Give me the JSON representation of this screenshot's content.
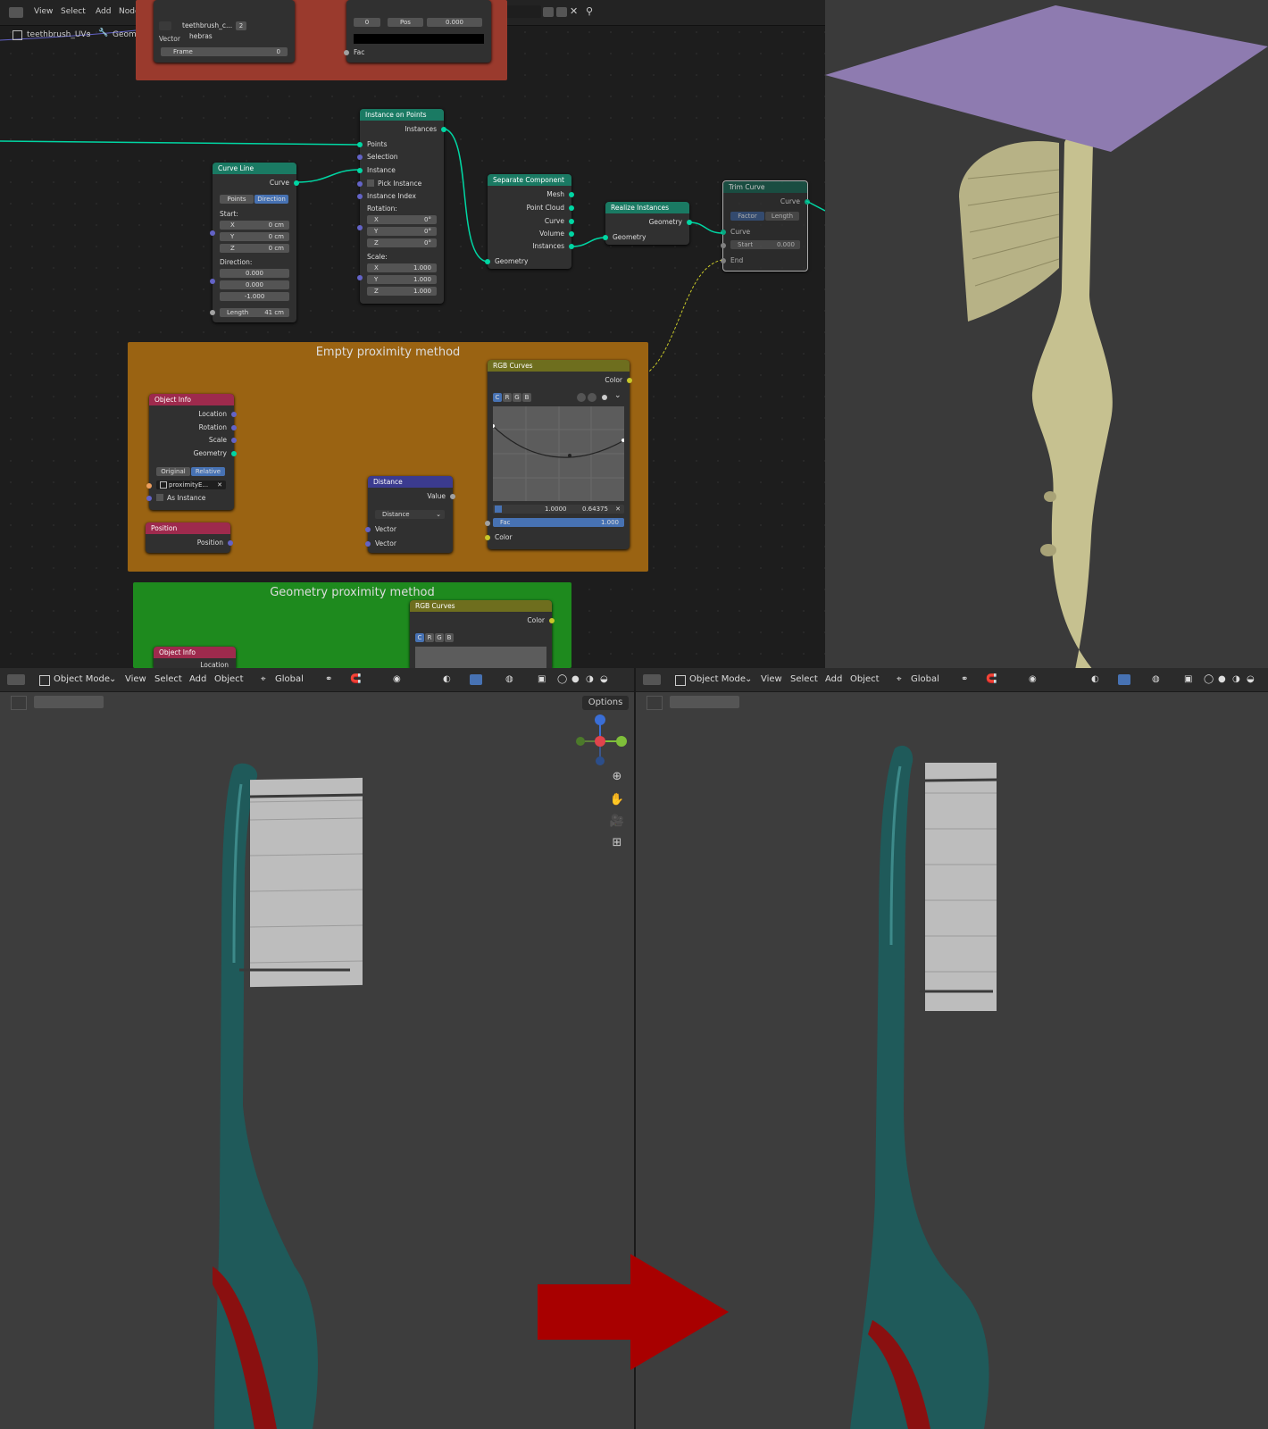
{
  "node_editor": {
    "menu": [
      "View",
      "Select",
      "Add",
      "Node"
    ],
    "tree_name": "hebras",
    "breadcrumb": [
      "teethbrush_UVs",
      "GeometryNodes",
      "hebras"
    ],
    "top_node": {
      "obj": "teethbrush_c...",
      "users": "2",
      "vector_label": "Vector",
      "frame_label": "Frame",
      "frame_value": "0",
      "fac_label": "Fac",
      "pos_label": "Pos",
      "pos_value": "0.000",
      "left_value": "0"
    },
    "instance_on_points": {
      "title": "Instance on Points",
      "out": "Instances",
      "inputs": [
        "Points",
        "Selection",
        "Instance",
        "Pick Instance",
        "Instance Index"
      ],
      "rotation_label": "Rotation:",
      "rotation": [
        [
          "X",
          "0°"
        ],
        [
          "Y",
          "0°"
        ],
        [
          "Z",
          "0°"
        ]
      ],
      "scale_label": "Scale:",
      "scale": [
        [
          "X",
          "1.000"
        ],
        [
          "Y",
          "1.000"
        ],
        [
          "Z",
          "1.000"
        ]
      ]
    },
    "curve_line": {
      "title": "Curve Line",
      "out": "Curve",
      "modes": [
        "Points",
        "Direction"
      ],
      "start_label": "Start:",
      "start": [
        [
          "X",
          "0 cm"
        ],
        [
          "Y",
          "0 cm"
        ],
        [
          "Z",
          "0 cm"
        ]
      ],
      "direction_label": "Direction:",
      "direction": [
        "0.000",
        "0.000",
        "-1.000"
      ],
      "length_label": "Length",
      "length_value": "41 cm"
    },
    "separate_component": {
      "title": "Separate Component",
      "outs": [
        "Mesh",
        "Point Cloud",
        "Curve",
        "Volume",
        "Instances"
      ],
      "in": "Geometry"
    },
    "realize_instances": {
      "title": "Realize Instances",
      "out": "Geometry",
      "in": "Geometry"
    },
    "trim_curve": {
      "title": "Trim Curve",
      "out": "Curve",
      "modes": [
        "Factor",
        "Length"
      ],
      "in_curve": "Curve",
      "start_label": "Start",
      "start_value": "0.000",
      "end_label": "End"
    },
    "frame_empty": {
      "title": "Empty proximity method"
    },
    "object_info": {
      "title": "Object Info",
      "outs": [
        "Location",
        "Rotation",
        "Scale",
        "Geometry"
      ],
      "modes": [
        "Original",
        "Relative"
      ],
      "object": "proximityE...",
      "as_instance": "As Instance"
    },
    "position": {
      "title": "Position",
      "out": "Position"
    },
    "distance": {
      "title": "Distance",
      "out": "Value",
      "mode": "Distance",
      "ins": [
        "Vector",
        "Vector"
      ]
    },
    "rgb_curves": {
      "title": "RGB Curves",
      "out": "Color",
      "channels": [
        "C",
        "R",
        "G",
        "B"
      ],
      "x_value": "1.0000",
      "y_value": "0.64375",
      "fac_label": "Fac",
      "fac_value": "1.000",
      "color_label": "Color"
    },
    "frame_geometry": {
      "title": "Geometry proximity method"
    },
    "object_info_2": {
      "title": "Object Info",
      "out": "Location"
    },
    "rgb_curves_2": {
      "title": "RGB Curves",
      "out": "Color",
      "channels": [
        "C",
        "R",
        "G",
        "B"
      ]
    }
  },
  "viewport_left": {
    "mode": "Object Mode",
    "menu": [
      "View",
      "Select",
      "Add",
      "Object"
    ],
    "orientation": "Global",
    "options": "Options"
  },
  "viewport_right": {
    "mode": "Object Mode",
    "menu": [
      "View",
      "Select",
      "Add",
      "Object"
    ],
    "orientation": "Global"
  },
  "colors": {
    "handle": "#1f5a5a",
    "bristle": "#bdbdbd",
    "accent_red": "#8a1010",
    "arrow": "#a80000",
    "plane": "#8e7bb0",
    "brush_3d": "#c6c190"
  }
}
